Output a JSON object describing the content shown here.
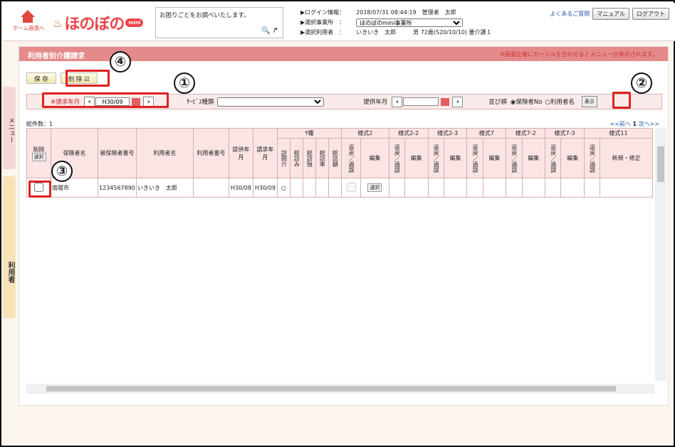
{
  "header": {
    "home_label": "ホーム画面へ",
    "logo_text": "ほのぼの",
    "logo_badge": "mini",
    "help_text": "お困りごとをお調べいたします。",
    "login_label": "ログイン情報：",
    "login_value": "2018/07/31 08:44:19　管理者　太郎",
    "office_label": "選択事業所　：",
    "office_value": "ほのぼのmini事業所",
    "user_label": "選択利用者　：",
    "user_value": "いきいき　太郎　　　男 72歳(S20/10/10) 要介護１",
    "faq": "よくあるご質問",
    "manual": "マニュアル",
    "logout": "ログアウト"
  },
  "side": {
    "menu": "メニュー",
    "user": "利用者"
  },
  "panel": {
    "title": "利用者別介護請求",
    "note": "※画面左端にカーソルを合わせるとメニューが表示されます。",
    "save": "保 存",
    "delete": "削 除",
    "delete_mark": "☑"
  },
  "filter": {
    "claim_label": "※請求年月",
    "claim_value": "H30/09",
    "service_label": "ｻｰﾋﾞｽ種類",
    "provide_label": "提供年月",
    "sort_label": "並び順",
    "sort_opt1": "保険者No",
    "sort_opt2": "利用者名",
    "show": "表示"
  },
  "list": {
    "total": "総件数：1",
    "pager_prev": "<<前へ",
    "pager_page": "1",
    "pager_next": "次へ>>"
  },
  "table": {
    "h_delete": "削除",
    "h_select": "選択",
    "h_insurer": "保険者名",
    "h_insured_no": "被保険者番号",
    "h_name": "利用者名",
    "h_userno": "利用者番号",
    "h_provide": "提供年月",
    "h_claim": "請求年月",
    "h_kind": "ｻ種",
    "h_kinds": [
      "訪問介",
      "総訪み",
      "総訪独",
      "総訪率",
      "総訪額"
    ],
    "h_forms": [
      "様式2",
      "様式2-2",
      "様式2-3",
      "様式7",
      "様式7-2",
      "様式7-3",
      "様式11"
    ],
    "h_back": "返戻／過誤",
    "h_edit": "編集",
    "h_new": "新規・修正",
    "row": {
      "insurer": "南陽市",
      "insured_no": "1234567890",
      "name": "いきいき　太郎",
      "provide": "H30/08",
      "claim": "H30/09",
      "mark": "○",
      "select": "選択"
    }
  },
  "callouts": [
    "①",
    "②",
    "③",
    "④"
  ],
  "colors": {
    "accent": "#e58a8a",
    "callout": "#e02020",
    "header_bg": "#fbe4e4"
  }
}
